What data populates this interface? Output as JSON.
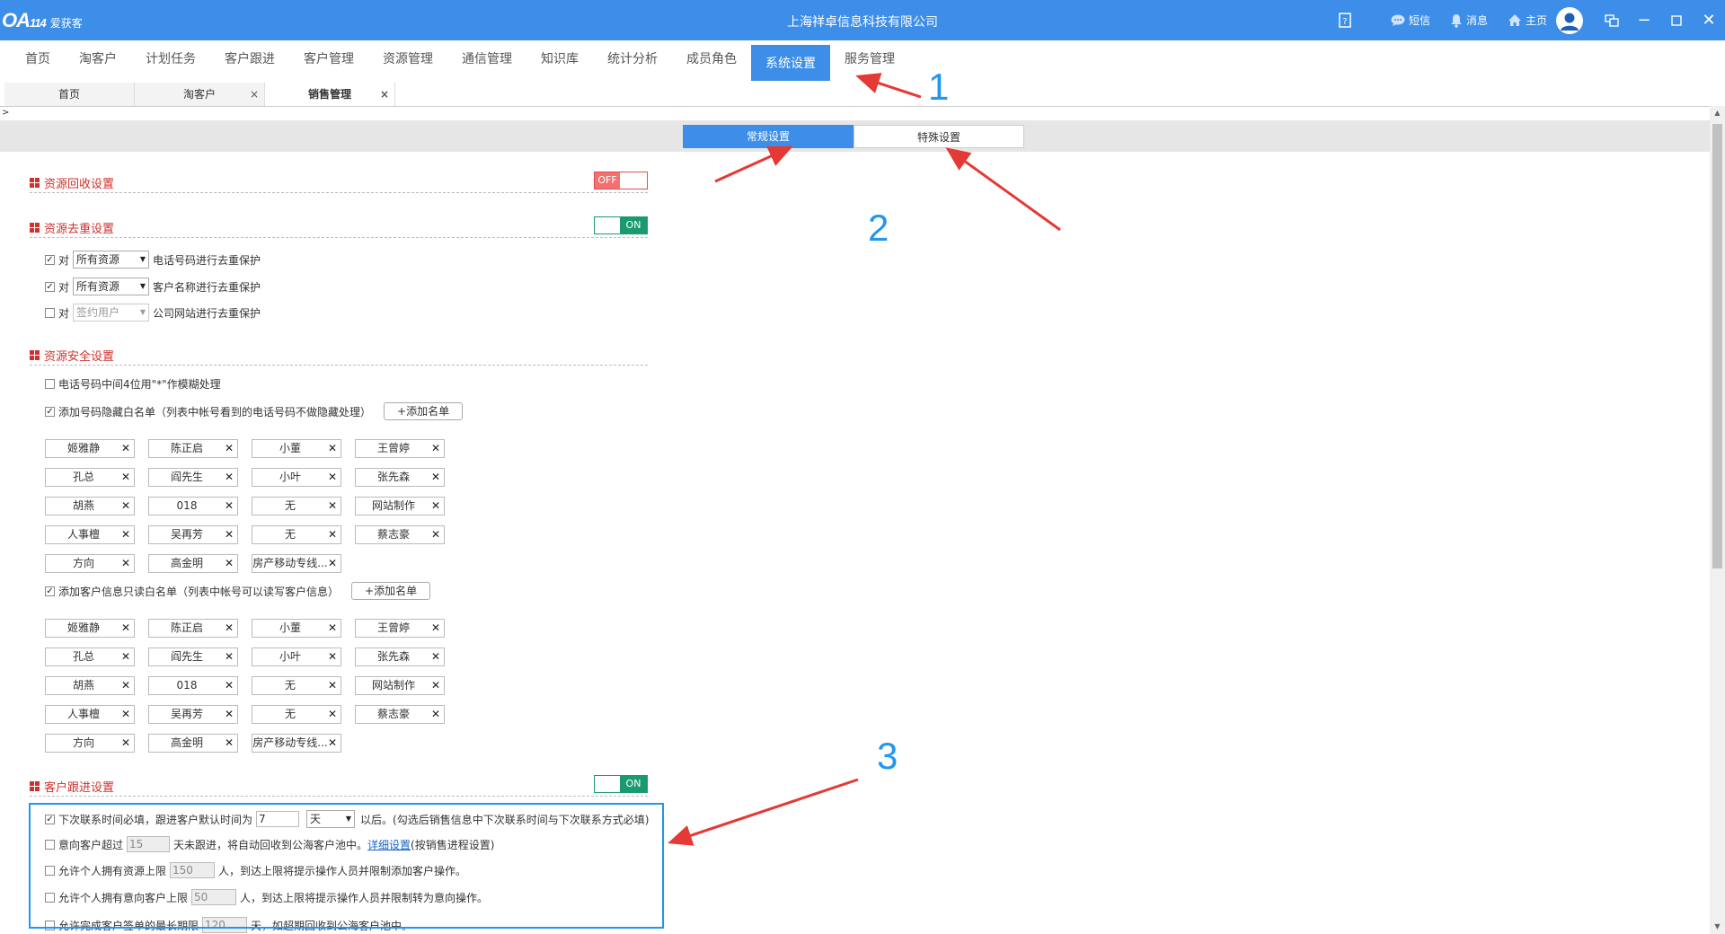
{
  "app": {
    "logo_mark": "OA",
    "logo_num": "114",
    "logo_name": "爱获客",
    "company": "上海祥卓信息科技有限公司",
    "right_items": [
      {
        "icon": "message-icon",
        "label": "短信"
      },
      {
        "icon": "bell-icon",
        "label": "消息"
      },
      {
        "icon": "home-icon",
        "label": "主页"
      }
    ]
  },
  "menu": [
    "首页",
    "淘客户",
    "计划任务",
    "客户跟进",
    "客户管理",
    "资源管理",
    "通信管理",
    "知识库",
    "统计分析",
    "成员角色",
    "系统设置",
    "服务管理"
  ],
  "menu_active_index": 10,
  "tabs": [
    {
      "label": "首页",
      "closable": false
    },
    {
      "label": "淘客户",
      "closable": true
    },
    {
      "label": "销售管理",
      "closable": true,
      "current": true
    }
  ],
  "expander": ">",
  "segments": {
    "general": "常规设置",
    "special": "特殊设置"
  },
  "sections": {
    "recycle": {
      "title": "资源回收设置",
      "toggle": "OFF"
    },
    "dedup": {
      "title": "资源去重设置",
      "toggle": "ON",
      "rows": [
        {
          "checked": true,
          "prefix": "对",
          "select": "所有资源",
          "disabled": false,
          "suffix": "电话号码进行去重保护"
        },
        {
          "checked": true,
          "prefix": "对",
          "select": "所有资源",
          "disabled": false,
          "suffix": "客户名称进行去重保护"
        },
        {
          "checked": false,
          "prefix": "对",
          "select": "签约用户",
          "disabled": true,
          "suffix": "公司网站进行去重保护"
        }
      ]
    },
    "security": {
      "title": "资源安全设置",
      "mask_label": "电话号码中间4位用\"*\"作模糊处理",
      "hidden_whitelist_label": "添加号码隐藏白名单（列表中帐号看到的电话号码不做隐藏处理）",
      "readonly_whitelist_label": "添加客户信息只读白名单（列表中帐号可以读写客户信息）",
      "add_button": "+添加名单",
      "names": [
        "姬雅静",
        "陈正启",
        "小董",
        "王曾婷",
        "孔总",
        "阎先生",
        "小叶",
        "张先森",
        "胡燕",
        "018",
        "无",
        "网站制作",
        "人事檀",
        "吴再芳",
        "无",
        "蔡志豪",
        "方向",
        "高金明",
        "房产移动专线..."
      ]
    },
    "followup": {
      "title": "客户跟进设置",
      "toggle": "ON",
      "r1_pre": "下次联系时间必填，跟进客户默认时间为",
      "r1_val": "7",
      "r1_unit": "天",
      "r1_post": "以后。(勾选后销售信息中下次联系时间与下次联系方式必填)",
      "r2_pre": "意向客户超过",
      "r2_val": "15",
      "r2_mid": "天未跟进，将自动回收到公海客户池中。",
      "r2_link": "详细设置",
      "r2_post": "(按销售进程设置)",
      "r3_pre": "允许个人拥有资源上限",
      "r3_val": "150",
      "r3_post": "人，到达上限将提示操作人员并限制添加客户操作。",
      "r4_pre": "允许个人拥有意向客户上限",
      "r4_val": "50",
      "r4_post": "人，到达上限将提示操作人员并限制转为意向操作。",
      "r5_pre": "允许完成客户签单的最长期限",
      "r5_val": "120",
      "r5_post": "天，如超期回收到公海客户池中。"
    }
  },
  "annotations": [
    "1",
    "2",
    "3"
  ],
  "colors": {
    "primary": "#3d8ee8",
    "section_title": "#d0312d",
    "toggle_on": "#1a9b6e",
    "toggle_off": "#f27070",
    "arrow": "#e53935",
    "annotation": "#2196f3"
  }
}
